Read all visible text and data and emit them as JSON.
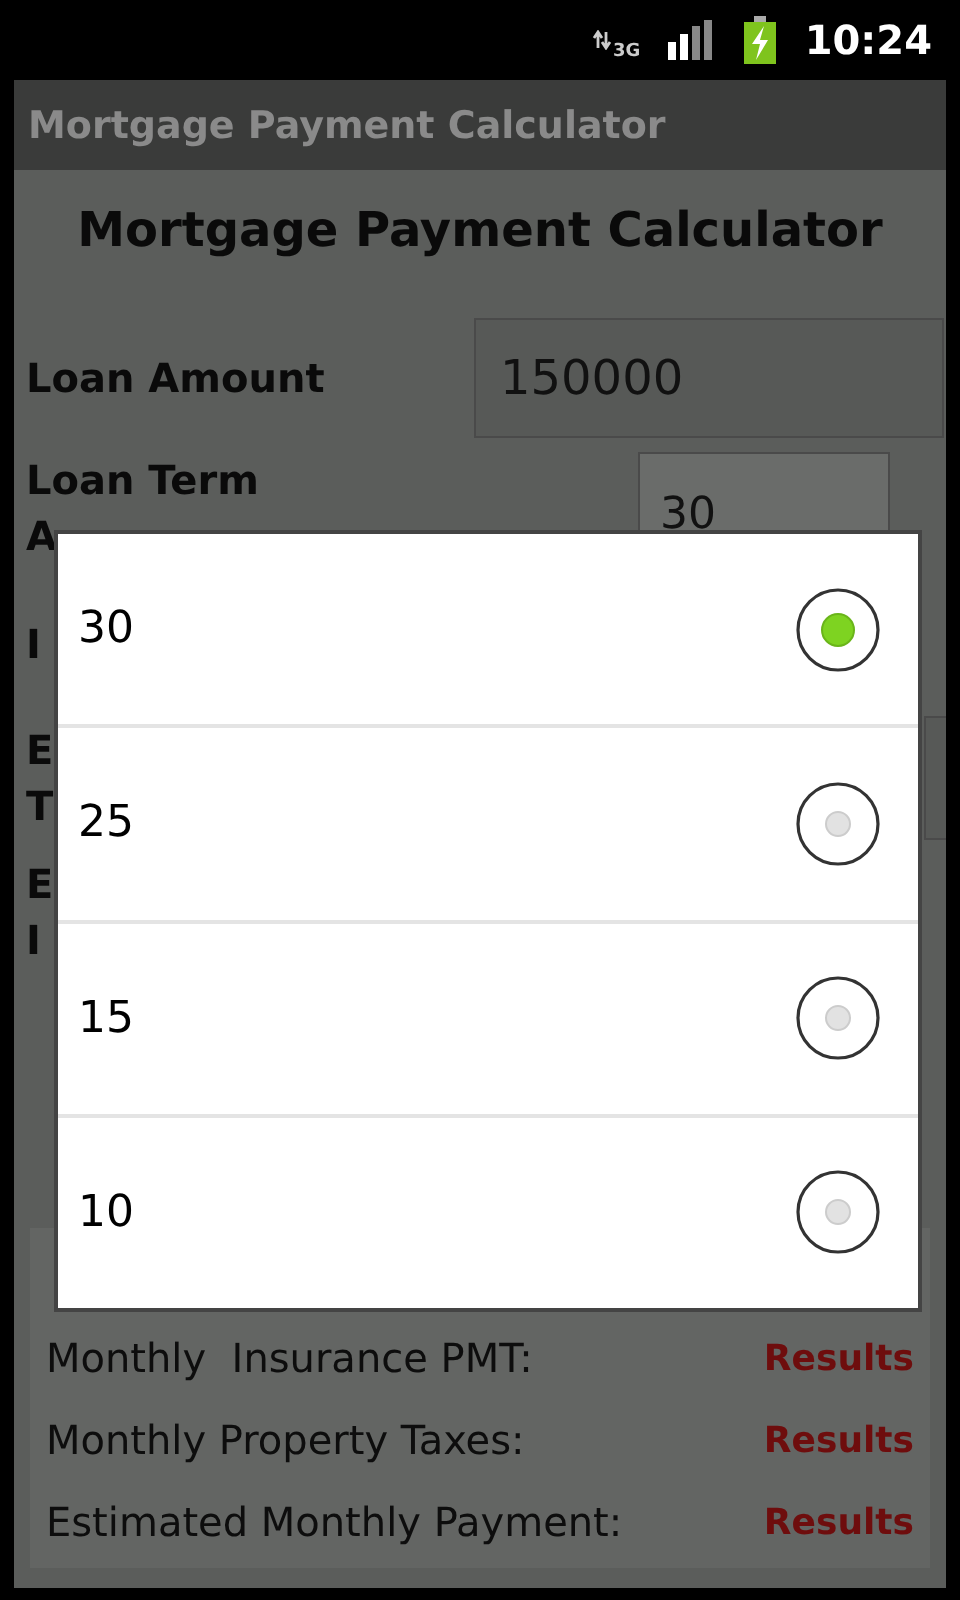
{
  "status_bar": {
    "network": "3G",
    "time": "10:24"
  },
  "app_bar": {
    "title": "Mortgage Payment Calculator"
  },
  "heading": "Mortgage Payment Calculator",
  "loan_amount": {
    "label": "Loan Amount",
    "value": "150000"
  },
  "loan_term": {
    "label_lines": [
      "Loan Term",
      "A"
    ],
    "value": "30"
  },
  "covered_rows": [
    {
      "label_lines": [
        "I"
      ],
      "kind": "text"
    },
    {
      "label_lines": [
        "E",
        "T"
      ],
      "kind": "field"
    },
    {
      "label_lines": [
        "E",
        "I"
      ],
      "kind": "text"
    }
  ],
  "results": [
    {
      "label": "Monthly  Insurance PMT:",
      "value": "Results"
    },
    {
      "label": "Monthly Property Taxes:",
      "value": "Results"
    },
    {
      "label": "Estimated Monthly Payment:",
      "value": "Results"
    }
  ],
  "dialog": {
    "options": [
      {
        "label": "30",
        "selected": true
      },
      {
        "label": "25",
        "selected": false
      },
      {
        "label": "15",
        "selected": false
      },
      {
        "label": "10",
        "selected": false
      }
    ]
  }
}
